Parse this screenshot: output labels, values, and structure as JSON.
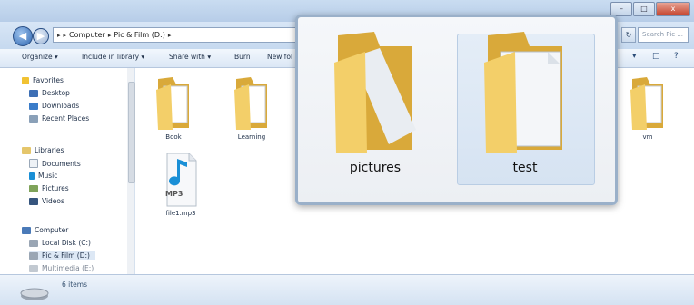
{
  "window": {
    "controls": {
      "minimize": "–",
      "maximize": "□",
      "close": "x"
    }
  },
  "address": {
    "crumbs": [
      "Computer",
      "Pic & Film (D:)"
    ],
    "search_placeholder": "Search Pic ..."
  },
  "toolbar": {
    "organize": "Organize ▾",
    "include": "Include in library ▾",
    "share": "Share with ▾",
    "burn": "Burn",
    "new_folder": "New fol",
    "views_icon": "▾",
    "pane_icon": "□",
    "help_icon": "?"
  },
  "sidebar": {
    "favorites": "Favorites",
    "desktop": "Desktop",
    "downloads": "Downloads",
    "recent": "Recent Places",
    "libraries": "Libraries",
    "documents": "Documents",
    "music": "Music",
    "pictures": "Pictures",
    "videos": "Videos",
    "computer": "Computer",
    "local_disk": "Local Disk (C:)",
    "pic_film": "Pic & Film (D:)",
    "media": "Multimedia (E:)"
  },
  "files": {
    "book": "Book",
    "learning": "Learning",
    "vm": "vm",
    "mp3_badge": "MP3",
    "mp3_name": "file1.mp3"
  },
  "status": {
    "count": "6 items"
  },
  "preview": {
    "pictures": "pictures",
    "test": "test"
  },
  "colors": {
    "folder_yellow": "#f3cf69",
    "folder_dark": "#d9a93a",
    "selection": "#d6e3f2",
    "music_blue": "#1a8fd6"
  }
}
